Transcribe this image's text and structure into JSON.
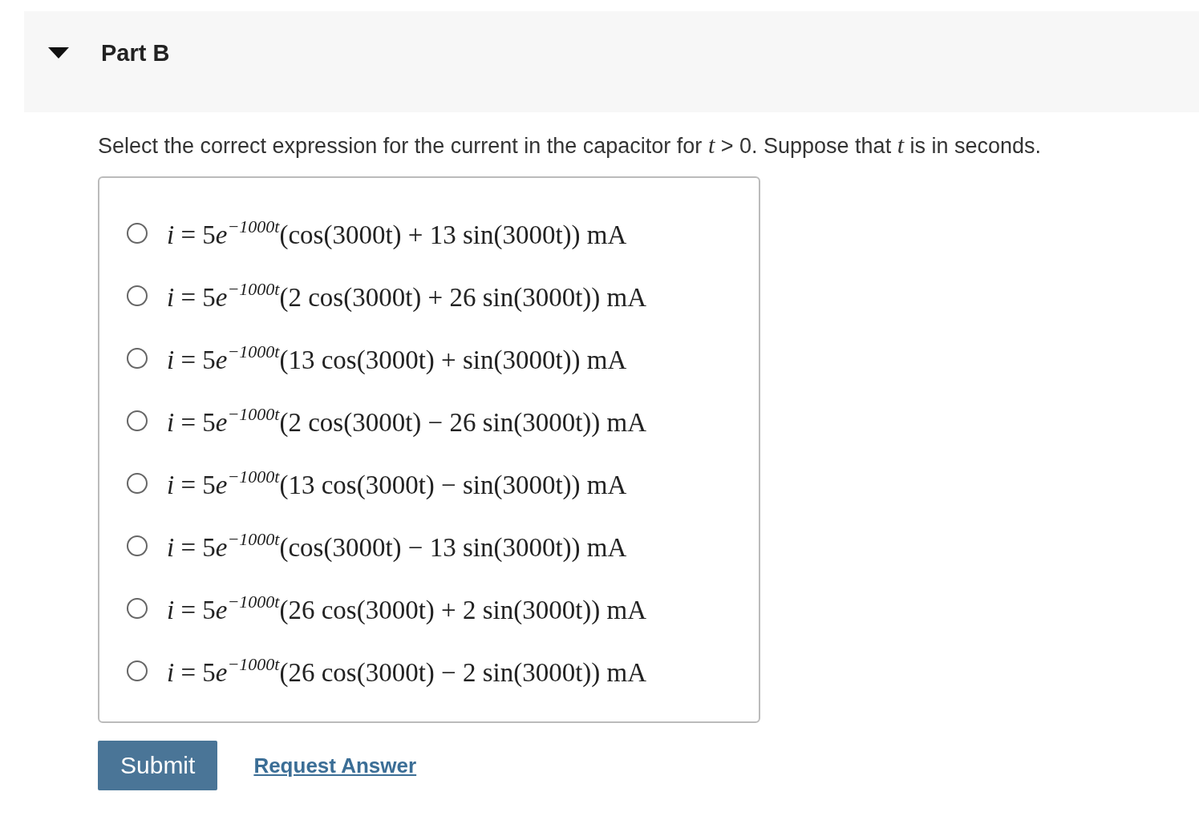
{
  "part": {
    "title": "Part B",
    "expanded": true
  },
  "prompt": "Select the correct expression for the current in the capacitor for *t* > 0. Suppose that *t* is in seconds.",
  "options": [
    {
      "variable": "i",
      "equals": "= 5",
      "base": "e",
      "exponent": "−1000t",
      "factor": "(cos(3000t) + 13 sin(3000t)) mA",
      "selected": false
    },
    {
      "variable": "i",
      "equals": "= 5",
      "base": "e",
      "exponent": "−1000t",
      "factor": "(2 cos(3000t) + 26 sin(3000t)) mA",
      "selected": false
    },
    {
      "variable": "i",
      "equals": "= 5",
      "base": "e",
      "exponent": "−1000t",
      "factor": "(13 cos(3000t) + sin(3000t)) mA",
      "selected": false
    },
    {
      "variable": "i",
      "equals": "= 5",
      "base": "e",
      "exponent": "−1000t",
      "factor": "(2 cos(3000t) − 26 sin(3000t)) mA",
      "selected": false
    },
    {
      "variable": "i",
      "equals": "= 5",
      "base": "e",
      "exponent": "−1000t",
      "factor": "(13 cos(3000t) − sin(3000t)) mA",
      "selected": false
    },
    {
      "variable": "i",
      "equals": "= 5",
      "base": "e",
      "exponent": "−1000t",
      "factor": "(cos(3000t) − 13 sin(3000t)) mA",
      "selected": false
    },
    {
      "variable": "i",
      "equals": "= 5",
      "base": "e",
      "exponent": "−1000t",
      "factor": "(26 cos(3000t) + 2 sin(3000t)) mA",
      "selected": false
    },
    {
      "variable": "i",
      "equals": "= 5",
      "base": "e",
      "exponent": "−1000t",
      "factor": "(26 cos(3000t) − 2 sin(3000t)) mA",
      "selected": false
    }
  ],
  "buttons": {
    "submit": "Submit",
    "request": "Request Answer"
  }
}
